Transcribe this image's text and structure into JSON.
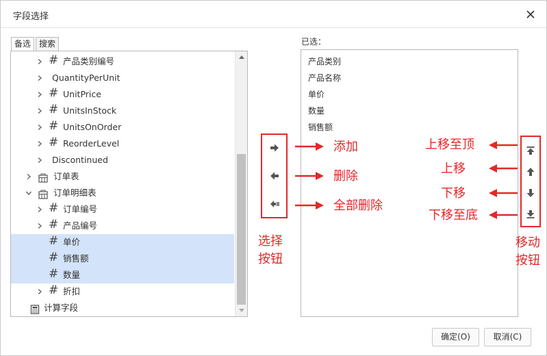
{
  "dialog": {
    "title": "字段选择"
  },
  "tabs": [
    "备选",
    "搜索"
  ],
  "tree": [
    {
      "label": "产品类别编号",
      "kind": "field",
      "chevron": "right",
      "selected": false
    },
    {
      "label": "QuantityPerUnit",
      "kind": "text",
      "chevron": "right",
      "selected": false
    },
    {
      "label": "UnitPrice",
      "kind": "field",
      "chevron": "right",
      "selected": false
    },
    {
      "label": "UnitsInStock",
      "kind": "field",
      "chevron": "right",
      "selected": false
    },
    {
      "label": "UnitsOnOrder",
      "kind": "field",
      "chevron": "right",
      "selected": false
    },
    {
      "label": "ReorderLevel",
      "kind": "field",
      "chevron": "right",
      "selected": false
    },
    {
      "label": "Discontinued",
      "kind": "text",
      "chevron": "right",
      "selected": false
    },
    {
      "label": "订单表",
      "kind": "table",
      "chevron": "right",
      "selected": false
    },
    {
      "label": "订单明细表",
      "kind": "table",
      "chevron": "down",
      "selected": false
    },
    {
      "label": "订单编号",
      "kind": "field",
      "chevron": "right",
      "selected": false
    },
    {
      "label": "产品编号",
      "kind": "field",
      "chevron": "right",
      "selected": false
    },
    {
      "label": "单价",
      "kind": "field",
      "chevron": "none",
      "selected": true
    },
    {
      "label": "销售额",
      "kind": "field",
      "chevron": "none",
      "selected": true
    },
    {
      "label": "数量",
      "kind": "field",
      "chevron": "none",
      "selected": true
    },
    {
      "label": "折扣",
      "kind": "field",
      "chevron": "right",
      "selected": false
    },
    {
      "label": "计算字段",
      "kind": "calc",
      "chevron": "none",
      "selected": false
    }
  ],
  "selected_panel": {
    "label": "已选：",
    "items": [
      "产品类别",
      "产品名称",
      "单价",
      "数量",
      "销售额"
    ]
  },
  "annotations": {
    "add": "添加",
    "delete": "删除",
    "delete_all": "全部删除",
    "select_buttons_line1": "选择",
    "select_buttons_line2": "按钮",
    "move_top": "上移至顶",
    "move_up": "上移",
    "move_down": "下移",
    "move_bottom": "下移至底",
    "move_buttons_line1": "移动",
    "move_buttons_line2": "按钮"
  },
  "footer": {
    "ok": "确定(O)",
    "cancel": "取消(C)"
  },
  "colors": {
    "annotation": "#e42828",
    "selection": "#d3e3f9"
  }
}
